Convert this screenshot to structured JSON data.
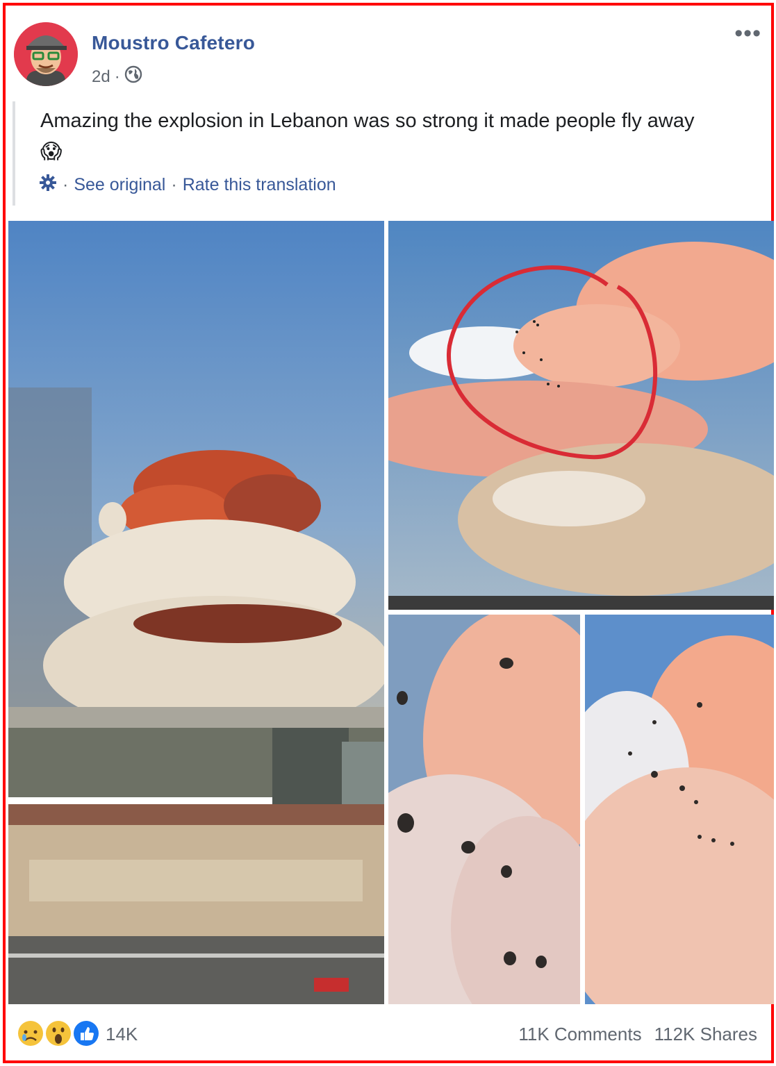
{
  "post": {
    "author": "Moustro Cafetero",
    "time": "2d",
    "separator": "·",
    "text": "Amazing the explosion in Lebanon was so strong it made people fly away",
    "emoji": "😱"
  },
  "translation": {
    "see_original": "See original",
    "rate": "Rate this translation"
  },
  "footer": {
    "reaction_count": "14K",
    "comments": "11K Comments",
    "shares": "112K Shares",
    "reactions": [
      "sad",
      "wow",
      "like"
    ]
  },
  "icons": {
    "more": "more-options-icon",
    "globe": "globe-icon",
    "gear": "gear-icon"
  },
  "colors": {
    "border": "#ff0000",
    "link": "#385898",
    "muted": "#606770"
  }
}
